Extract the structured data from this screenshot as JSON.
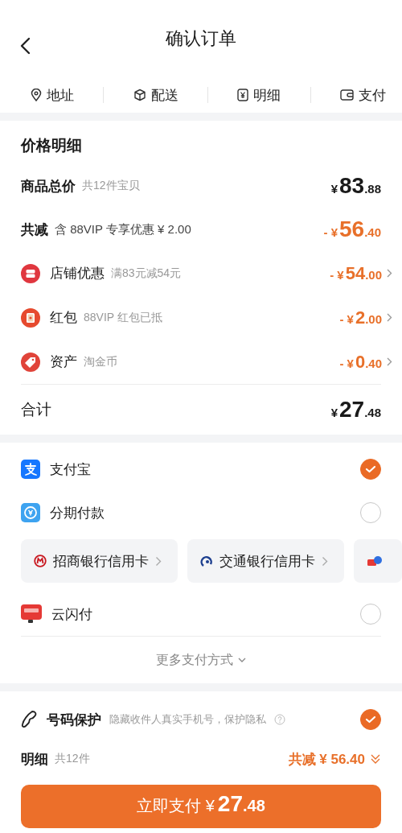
{
  "header": {
    "title": "确认订单"
  },
  "steps": [
    {
      "label": "地址"
    },
    {
      "label": "配送"
    },
    {
      "label": "明细"
    },
    {
      "label": "支付"
    }
  ],
  "price_detail": {
    "title": "价格明细",
    "total": {
      "label": "商品总价",
      "note": "共12件宝贝",
      "currency": "¥",
      "main": "83",
      "decimal": ".88"
    },
    "reduction": {
      "label": "共减",
      "note": "含 88VIP 专享优惠 ¥ 2.00",
      "sign": "-",
      "currency": "¥",
      "main": "56",
      "decimal": ".40"
    },
    "discounts": [
      {
        "label": "店铺优惠",
        "note": "满83元减54元",
        "sign": "-",
        "currency": "¥",
        "main": "54",
        "decimal": ".00"
      },
      {
        "label": "红包",
        "note": "88VIP 红包已抵",
        "sign": "-",
        "currency": "¥",
        "main": "2",
        "decimal": ".00"
      },
      {
        "label": "资产",
        "note": "淘金币",
        "sign": "-",
        "currency": "¥",
        "main": "0",
        "decimal": ".40"
      }
    ],
    "sum": {
      "label": "合计",
      "currency": "¥",
      "main": "27",
      "decimal": ".48"
    }
  },
  "payment": {
    "items": [
      {
        "kind": "method",
        "label": "支付宝",
        "selected": true
      },
      {
        "kind": "method",
        "label": "分期付款",
        "selected": false
      },
      {
        "kind": "cards",
        "cards": [
          {
            "kind": "bank",
            "label": "招商银行信用卡"
          },
          {
            "kind": "bank",
            "label": "交通银行信用卡"
          },
          {
            "kind": "bank"
          }
        ]
      },
      {
        "kind": "method",
        "label": "云闪付",
        "selected": false
      }
    ],
    "more": "更多支付方式"
  },
  "protection": {
    "label": "号码保护",
    "note": "隐藏收件人真实手机号，保护隐私",
    "checked": true
  },
  "summary": {
    "label": "明细",
    "note": "共12件",
    "reduction": "共减 ¥ 56.40"
  },
  "pay_button": {
    "label": "立即支付",
    "currency": "¥",
    "main": "27",
    "decimal": ".48"
  }
}
